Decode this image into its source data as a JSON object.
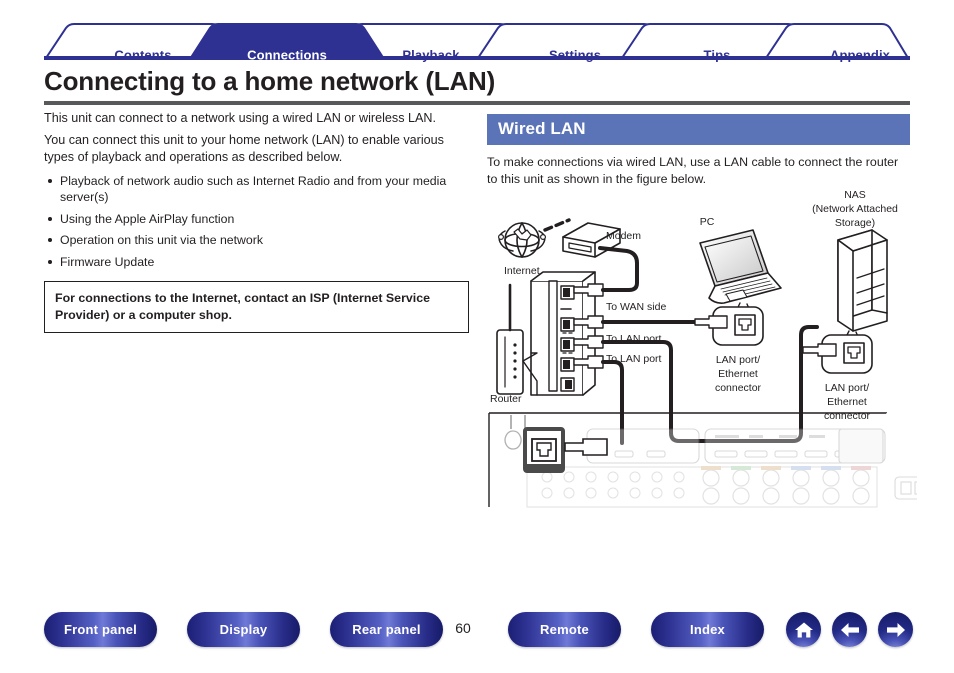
{
  "tabs": [
    {
      "label": "Contents",
      "active": false
    },
    {
      "label": "Connections",
      "active": true
    },
    {
      "label": "Playback",
      "active": false
    },
    {
      "label": "Settings",
      "active": false
    },
    {
      "label": "Tips",
      "active": false
    },
    {
      "label": "Appendix",
      "active": false
    }
  ],
  "page": {
    "title": "Connecting to a home network (LAN)",
    "number": "60"
  },
  "left": {
    "intro1": "This unit can connect to a network using a wired LAN or wireless LAN.",
    "intro2": "You can connect this unit to your home network (LAN) to enable various types of playback and operations as described below.",
    "bullets": [
      "Playback of network audio such as Internet Radio and from your media server(s)",
      "Using the Apple AirPlay function",
      "Operation on this unit via the network",
      "Firmware Update"
    ],
    "isp_note": "For connections to the Internet, contact an ISP (Internet Service Provider) or a computer shop."
  },
  "right": {
    "section_title": "Wired LAN",
    "section_text": "To make connections via wired LAN, use a LAN cable to connect the router to this unit as shown in the figure below."
  },
  "diagram": {
    "labels": {
      "internet": "Internet",
      "modem": "Modem",
      "router": "Router",
      "to_wan": "To WAN side",
      "to_lan_1": "To LAN port",
      "to_lan_2": "To LAN port",
      "pc": "PC",
      "nas_line1": "NAS",
      "nas_line2": "(Network Attached",
      "nas_line3": "Storage)",
      "pc_port_line1": "LAN port/",
      "pc_port_line2": "Ethernet",
      "pc_port_line3": "connector",
      "nas_port_line1": "LAN port/",
      "nas_port_line2": "Ethernet",
      "nas_port_line3": "connector"
    }
  },
  "footer": {
    "buttons": [
      {
        "label": "Front panel"
      },
      {
        "label": "Display"
      },
      {
        "label": "Rear panel"
      },
      {
        "label": "Remote"
      },
      {
        "label": "Index"
      }
    ],
    "icons": [
      {
        "name": "home-icon"
      },
      {
        "name": "arrow-left-icon"
      },
      {
        "name": "arrow-right-icon"
      }
    ]
  },
  "colors": {
    "brand_blue": "#2e3192",
    "section_blue": "#5b74b8",
    "rule_gray": "#58595b",
    "text": "#231f20"
  }
}
